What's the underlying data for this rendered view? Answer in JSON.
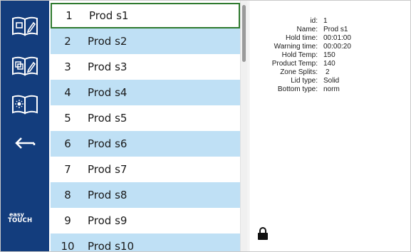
{
  "sidebar": {
    "buttons": [
      {
        "name": "book-edit-icon"
      },
      {
        "name": "book-copy-icon"
      },
      {
        "name": "book-day-night-icon"
      },
      {
        "name": "back-arrow-icon"
      }
    ],
    "brand": {
      "line1": "easy",
      "line2": "TOUCH"
    }
  },
  "product_list": [
    {
      "num": "1",
      "name": "Prod s1"
    },
    {
      "num": "2",
      "name": "Prod s2"
    },
    {
      "num": "3",
      "name": "Prod s3"
    },
    {
      "num": "4",
      "name": "Prod s4"
    },
    {
      "num": "5",
      "name": "Prod s5"
    },
    {
      "num": "6",
      "name": "Prod s6"
    },
    {
      "num": "7",
      "name": "Prod s7"
    },
    {
      "num": "8",
      "name": "Prod s8"
    },
    {
      "num": "9",
      "name": "Prod s9"
    },
    {
      "num": "10",
      "name": "Prod s10"
    }
  ],
  "selected_index": 0,
  "details": [
    {
      "label": "id:",
      "value": "1"
    },
    {
      "label": "Name:",
      "value": "Prod s1"
    },
    {
      "label": "Hold time:",
      "value": "00:01:00"
    },
    {
      "label": "Warning time:",
      "value": "00:00:20"
    },
    {
      "label": "Hold Temp:",
      "value": "150"
    },
    {
      "label": "Product Temp:",
      "value": "140"
    },
    {
      "label": "Zone Splits:",
      "value": "2"
    },
    {
      "label": "Lid type:",
      "value": "Solid"
    },
    {
      "label": "Bottom type:",
      "value": "norm"
    }
  ],
  "colors": {
    "sidebar": "#133d7d",
    "row_alt": "#bfe0f5",
    "selected_border": "#2f7a2f"
  }
}
